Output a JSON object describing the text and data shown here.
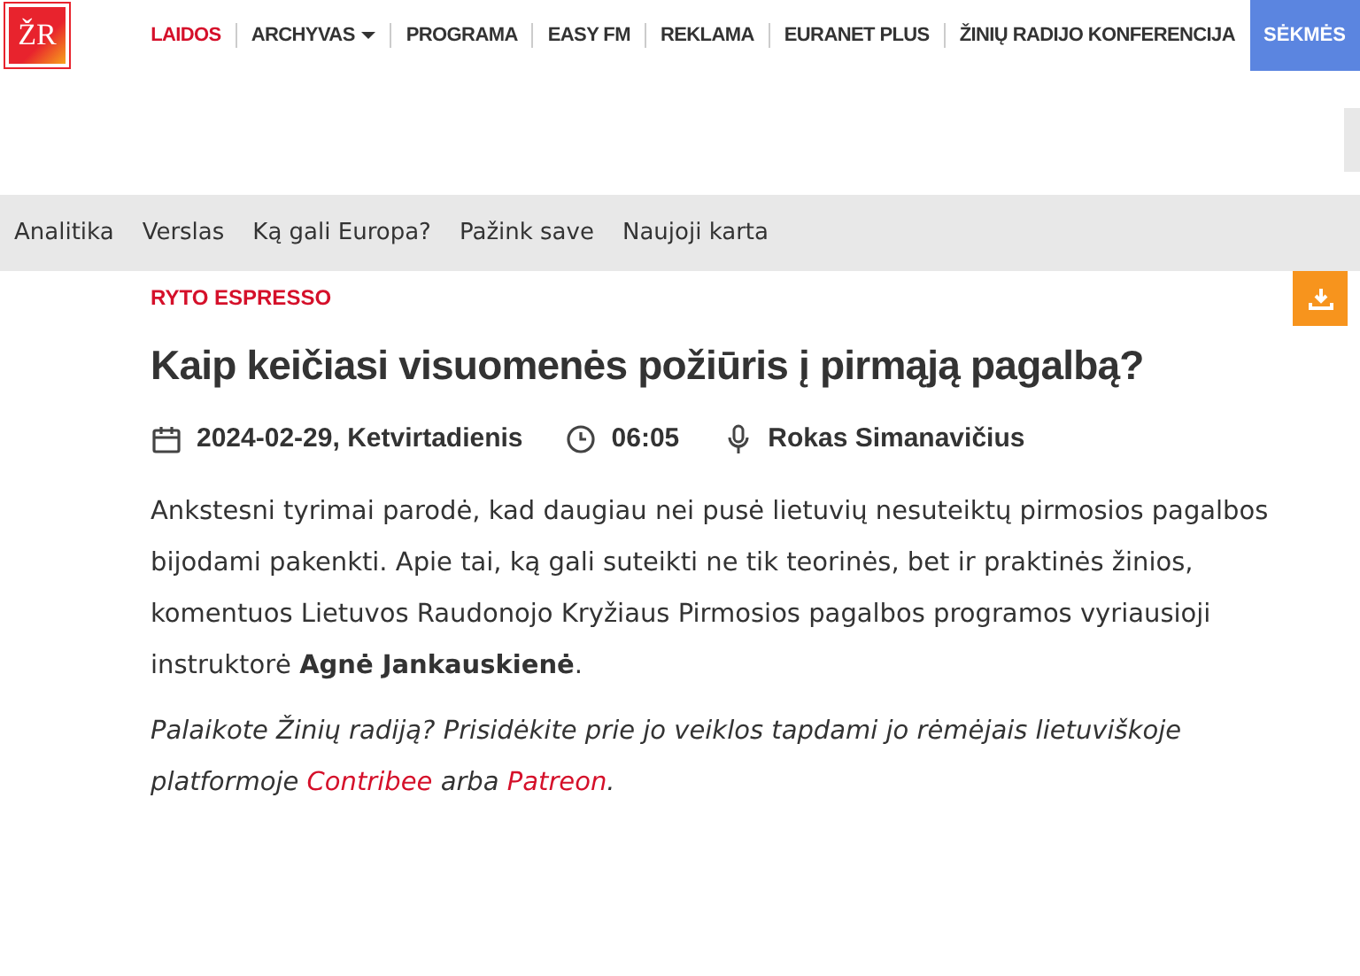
{
  "logo": {
    "text": "ŽR"
  },
  "main_nav": [
    {
      "label": "LAIDOS",
      "selected": true,
      "dropdown": false
    },
    {
      "label": "ARCHYVAS",
      "selected": false,
      "dropdown": true
    },
    {
      "label": "PROGRAMA",
      "selected": false,
      "dropdown": false
    },
    {
      "label": "EASY FM",
      "selected": false,
      "dropdown": false
    },
    {
      "label": "REKLAMA",
      "selected": false,
      "dropdown": false
    },
    {
      "label": "EURANET PLUS",
      "selected": false,
      "dropdown": false
    },
    {
      "label": "ŽINIŲ RADIJO KONFERENCIJA",
      "selected": false,
      "dropdown": false
    }
  ],
  "nav_button": {
    "label": "SĖKMĖS"
  },
  "sub_nav": [
    "Analitika",
    "Verslas",
    "Ką gali Europa?",
    "Pažink save",
    "Naujoji karta"
  ],
  "article": {
    "category": "RYTO ESPRESSO",
    "title": "Kaip keičiasi visuomenės požiūris į pirmąją pagalbą?",
    "meta": [
      {
        "kind": "date",
        "text": "2024-02-29, Ketvirtadienis"
      },
      {
        "kind": "time",
        "text": "06:05"
      },
      {
        "kind": "host",
        "text": "Rokas Simanavičius"
      }
    ],
    "lead": "Ankstesni tyrimai parodė, kad daugiau nei pusė lietuvių nesuteiktų pirmosios pagalbos bijodami pakenkti. Apie tai, ką gali suteikti ne tik teorinės, bet ir praktinės žinios, komentuos Lietuvos Raudonojo Kryžiaus Pirmosios pagalbos programos vyriausioji instruktorė **Agnė Jankauskienė**.",
    "support": [
      {
        "kind": "text",
        "text": "Palaikote Žinių radiją? Prisidėkite prie jo veiklos tapdami jo rėmėjais lietuviškoje platformoje "
      },
      {
        "kind": "link",
        "text": "Contribee"
      },
      {
        "kind": "text",
        "text": " arba "
      },
      {
        "kind": "link",
        "text": "Patreon"
      },
      {
        "kind": "text",
        "text": "."
      }
    ]
  }
}
